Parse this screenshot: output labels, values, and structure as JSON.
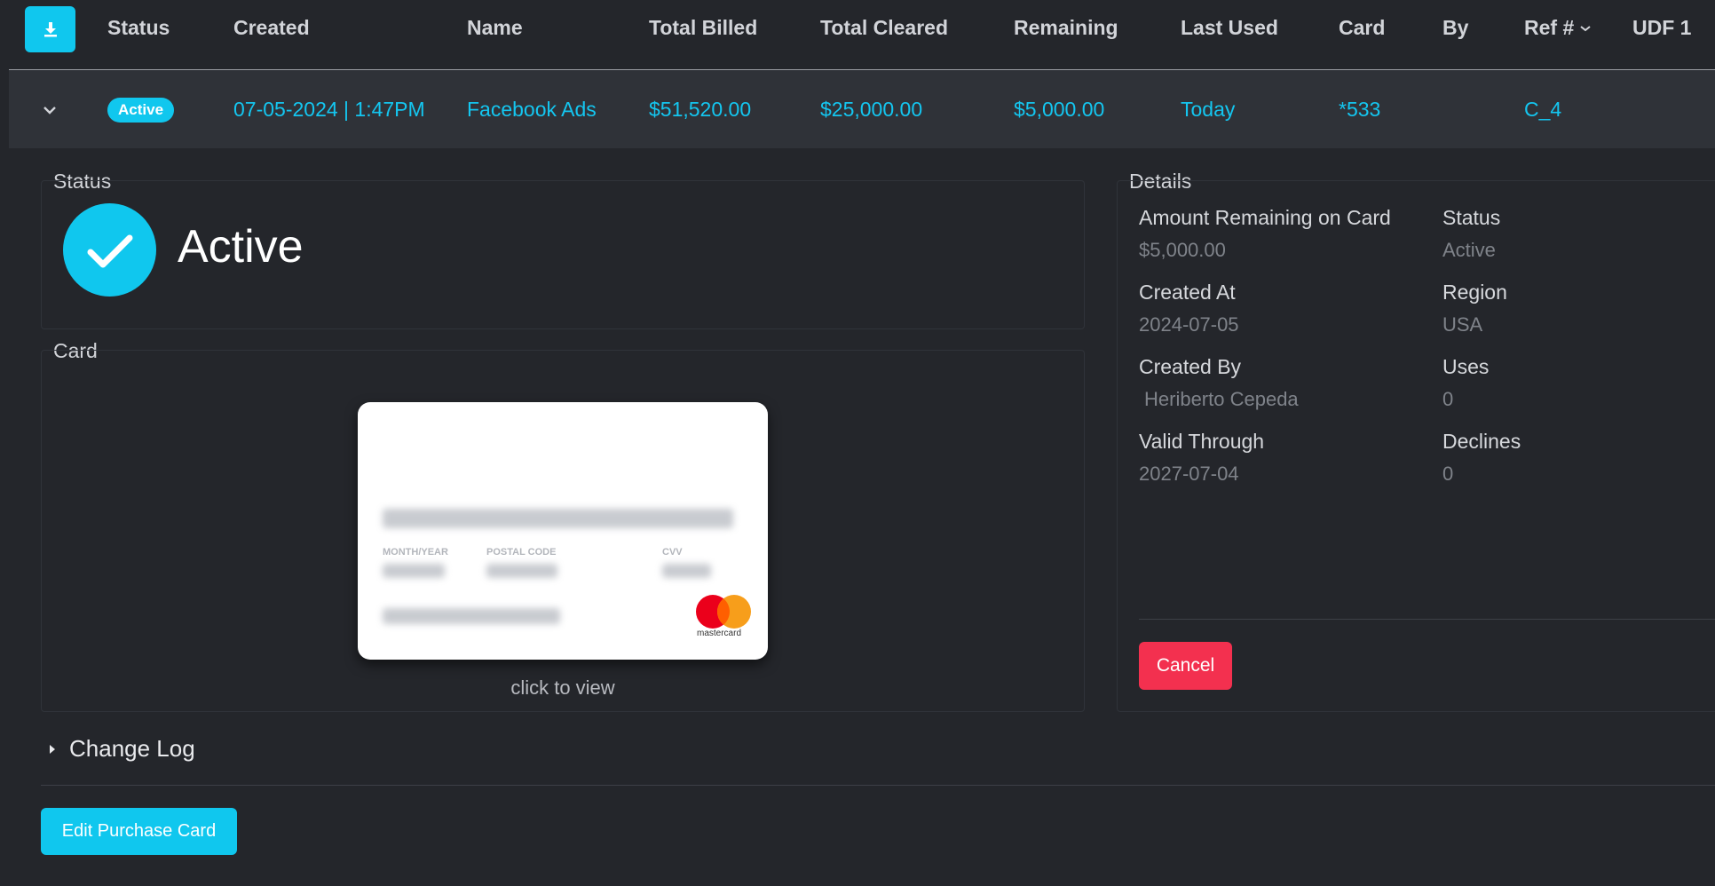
{
  "header": {
    "columns": [
      "Status",
      "Created",
      "Name",
      "Total Billed",
      "Total Cleared",
      "Remaining",
      "Last Used",
      "Card",
      "By",
      "Ref #",
      "UDF 1"
    ]
  },
  "row": {
    "status": "Active",
    "created": "07-05-2024 | 1:47PM",
    "name": "Facebook Ads",
    "total_billed": "$51,520.00",
    "total_cleared": "$25,000.00",
    "remaining": "$5,000.00",
    "last_used": "Today",
    "card": "*533",
    "by": "",
    "ref": "C_4"
  },
  "status_panel": {
    "title": "Status",
    "value": "Active"
  },
  "card_panel": {
    "title": "Card",
    "labels": {
      "month_year": "MONTH/YEAR",
      "postal_code": "POSTAL CODE",
      "cvv": "CVV"
    },
    "brand": "mastercard",
    "click_hint": "click to view"
  },
  "details": {
    "title": "Details",
    "left": [
      {
        "label": "Amount Remaining on Card",
        "value": "$5,000.00"
      },
      {
        "label": "Created At",
        "value": "2024-07-05"
      },
      {
        "label": "Created By",
        "value": "Heriberto Cepeda"
      },
      {
        "label": "Valid Through",
        "value": "2027-07-04"
      }
    ],
    "right": [
      {
        "label": "Status",
        "value": "Active"
      },
      {
        "label": "Region",
        "value": "USA"
      },
      {
        "label": "Uses",
        "value": "0"
      },
      {
        "label": "Declines",
        "value": "0"
      }
    ],
    "cancel_label": "Cancel"
  },
  "change_log": {
    "label": "Change Log"
  },
  "actions": {
    "edit_label": "Edit Purchase Card"
  },
  "colors": {
    "accent": "#10c7ee",
    "danger": "#f3304f",
    "background": "#24262b",
    "row": "#2f3238"
  }
}
